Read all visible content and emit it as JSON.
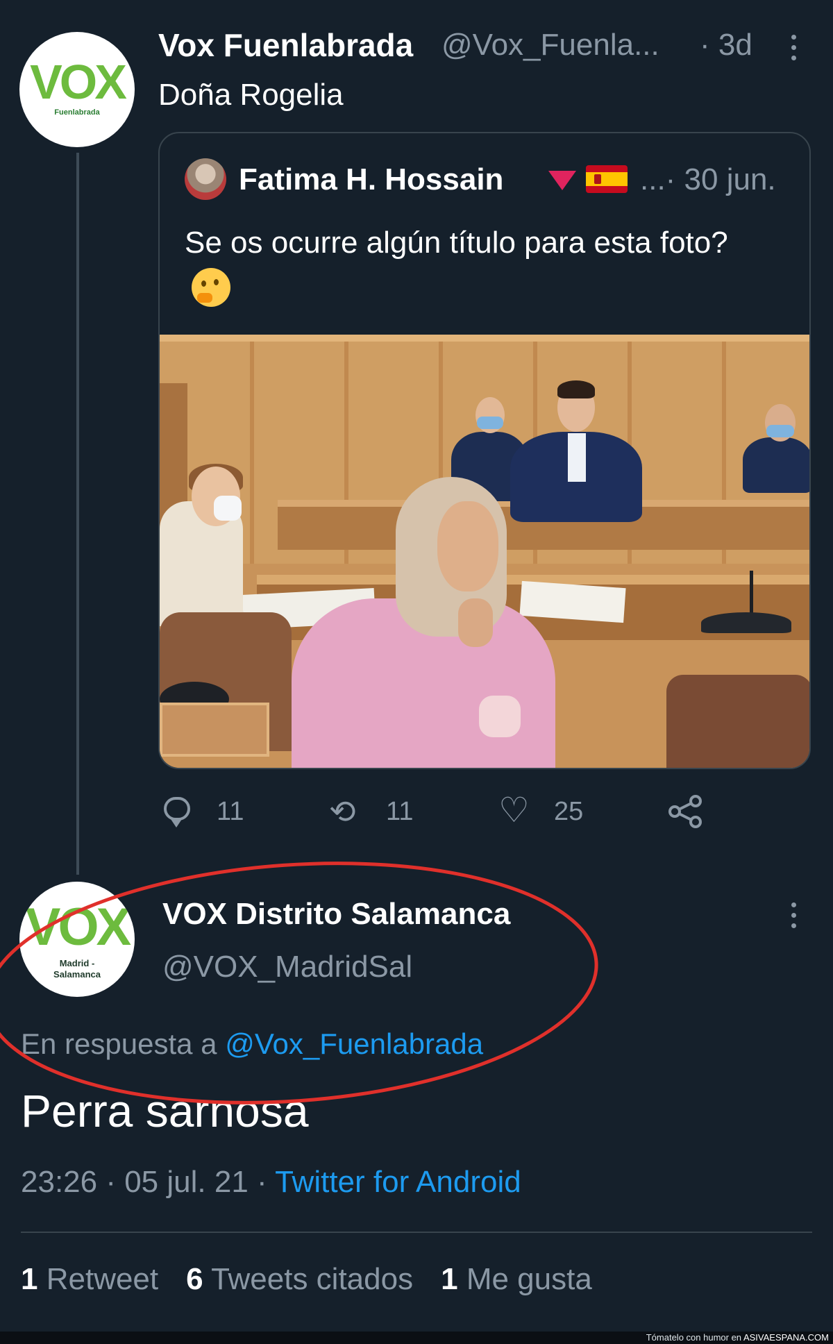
{
  "tweet": {
    "avatar_brand": "VOX",
    "avatar_sub": "Fuenlabrada",
    "author_name": "Vox Fuenlabrada",
    "author_handle": "@Vox_Fuenla...",
    "time": "· 3d",
    "text": "Doña Rogelia",
    "quoted": {
      "author_name": "Fatima H. Hossain",
      "time": "...· 30 jun.",
      "text": "Se os ocurre algún título para esta foto?",
      "emoji": "thinking-face-emoji"
    },
    "actions": {
      "replies": "11",
      "retweets": "11",
      "likes": "25"
    }
  },
  "reply": {
    "avatar_brand": "VOX",
    "avatar_sub_1": "Madrid -",
    "avatar_sub_2": "Salamanca",
    "author_name": "VOX Distrito Salamanca",
    "author_handle": "@VOX_MadridSal",
    "reply_to_prefix": "En respuesta a",
    "reply_to_mention": "@Vox_Fuenlabrada",
    "text": "Perra sarnosa",
    "timestamp": "23:26 · 05 jul. 21 ·",
    "source": "Twitter for Android",
    "stats": {
      "retweets_count": "1",
      "retweets_label": "Retweet",
      "quotes_count": "6",
      "quotes_label": "Tweets citados",
      "likes_count": "1",
      "likes_label": "Me gusta"
    }
  },
  "watermark": {
    "prefix": "Tómatelo con humor en",
    "site": "ASIVAESPANA.COM"
  },
  "colors": {
    "background": "#15202b",
    "secondary_text": "#8b98a5",
    "link": "#1d9bf0",
    "vox_green": "#6dbb3e",
    "annotation_red": "#e0302b"
  }
}
